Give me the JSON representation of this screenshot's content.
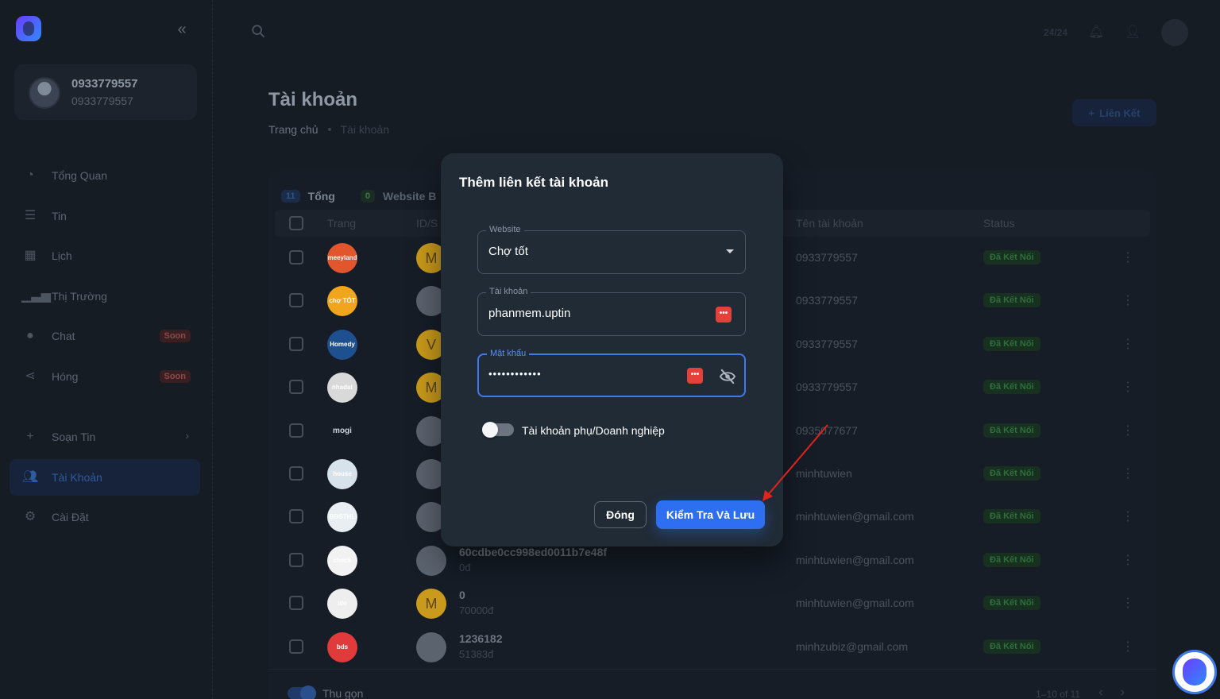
{
  "sidebar": {
    "user": {
      "name": "0933779557",
      "sub": "0933779557"
    },
    "items": [
      {
        "label": "Tổng Quan",
        "icon": "dashboard-icon",
        "badge": ""
      },
      {
        "label": "Tin",
        "icon": "list-icon",
        "badge": ""
      },
      {
        "label": "Lịch",
        "icon": "calendar-icon",
        "badge": ""
      },
      {
        "label": "Thị Trường",
        "icon": "chart-icon",
        "badge": ""
      },
      {
        "label": "Chat",
        "icon": "chat-icon",
        "badge": "Soon"
      },
      {
        "label": "Hóng",
        "icon": "share-icon",
        "badge": "Soon"
      },
      {
        "label": "Soạn Tin",
        "icon": "plus-icon",
        "badge": ""
      },
      {
        "label": "Tài Khoản",
        "icon": "users-icon",
        "badge": ""
      },
      {
        "label": "Cài Đặt",
        "icon": "gear-icon",
        "badge": ""
      }
    ]
  },
  "topbar": {
    "count": "24/24"
  },
  "header": {
    "title": "Tài khoản",
    "breadcrumb": {
      "home": "Trang chủ",
      "current": "Tài khoản"
    },
    "link_button": "Liên Kết"
  },
  "table": {
    "tabs": [
      {
        "count": "11",
        "label": "Tổng"
      },
      {
        "count": "0",
        "label": "Website B"
      }
    ],
    "columns": {
      "page": "Trang",
      "id": "ID/S",
      "account": "Tên tài khoản",
      "status": "Status"
    },
    "rows": [
      {
        "site": "meeyland",
        "avatar": "M",
        "id": "",
        "sub": "",
        "account": "0933779557",
        "status": "Đã Kết Nối"
      },
      {
        "site": "chợ TỐT",
        "avatar": "",
        "id": "",
        "sub": "",
        "account": "0933779557",
        "status": "Đã Kết Nối"
      },
      {
        "site": "Homedy",
        "avatar": "V",
        "id": "",
        "sub": "",
        "account": "0933779557",
        "status": "Đã Kết Nối"
      },
      {
        "site": "nhadat",
        "avatar": "M",
        "id": "",
        "sub": "",
        "account": "0933779557",
        "status": "Đã Kết Nối"
      },
      {
        "site": "mogi",
        "avatar": "",
        "id": "",
        "sub": "",
        "account": "0935077677",
        "status": "Đã Kết Nối"
      },
      {
        "site": "house",
        "avatar": "",
        "id": "",
        "sub": "",
        "account": "minhtuwien",
        "status": "Đã Kết Nối"
      },
      {
        "site": "BĐSTHL",
        "avatar": "",
        "id": "",
        "sub": "",
        "account": "minhtuwien@gmail.com",
        "status": "Đã Kết Nối"
      },
      {
        "site": "check",
        "avatar": "",
        "id": "60cdbe0cc998ed0011b7e48f",
        "sub": "0đ",
        "account": "minhtuwien@gmail.com",
        "status": "Đã Kết Nối"
      },
      {
        "site": "alo",
        "avatar": "M",
        "id": "0",
        "sub": "70000đ",
        "account": "minhtuwien@gmail.com",
        "status": "Đã Kết Nối"
      },
      {
        "site": "bds",
        "avatar": "",
        "id": "1236182",
        "sub": "51383đ",
        "account": "minhzubiz@gmail.com",
        "status": "Đã Kết Nối"
      }
    ],
    "footer": {
      "collapse_label": "Thu gọn",
      "pager": "1–10 of 11"
    }
  },
  "modal": {
    "title": "Thêm liên kết tài khoản",
    "website": {
      "label": "Website",
      "value": "Chợ tốt"
    },
    "account": {
      "label": "Tài khoản",
      "value": "phanmem.uptin"
    },
    "password": {
      "label": "Mật khẩu",
      "value": "••••••••••••"
    },
    "switch_label": "Tài khoản phụ/Doanh nghiệp",
    "close_label": "Đóng",
    "save_label": "Kiểm Tra Và Lưu"
  },
  "colors": {
    "primary": "#2d6ff0",
    "focus": "#3f7ae8",
    "annotation": "#e0231c",
    "password_manager": "#e5403a"
  }
}
